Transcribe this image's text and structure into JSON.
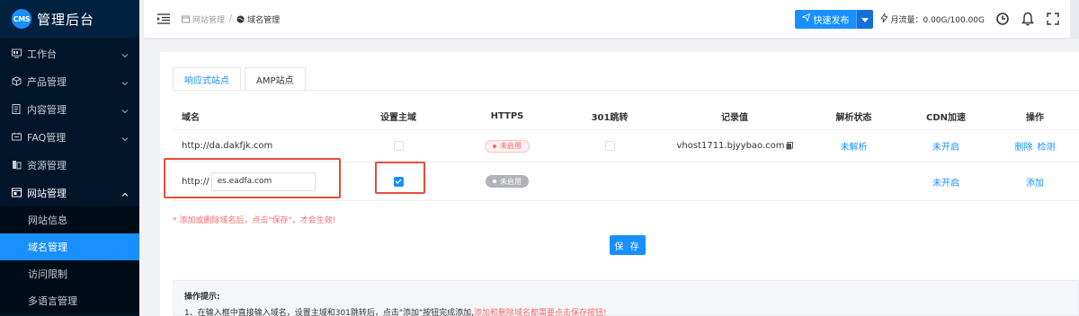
{
  "brand": {
    "logo": "CMS",
    "title": "管理后台"
  },
  "sidebar": {
    "items": [
      {
        "label": "工作台",
        "icon": "dashboard-icon",
        "caret": true
      },
      {
        "label": "产品管理",
        "icon": "cube-icon",
        "caret": true
      },
      {
        "label": "内容管理",
        "icon": "document-icon",
        "caret": true
      },
      {
        "label": "FAQ管理",
        "icon": "faq-icon",
        "caret": true
      },
      {
        "label": "资源管理",
        "icon": "resource-icon",
        "caret": false
      },
      {
        "label": "网站管理",
        "icon": "website-icon",
        "caret": true,
        "open": true
      }
    ],
    "subitems": [
      {
        "label": "网站信息",
        "active": false
      },
      {
        "label": "域名管理",
        "active": true
      },
      {
        "label": "访问限制",
        "active": false
      },
      {
        "label": "多语言管理",
        "active": false
      }
    ]
  },
  "header": {
    "breadcrumb": {
      "parent": "网站管理",
      "separator": "/",
      "current": "域名管理"
    },
    "publish_label": "快速发布",
    "flow_label": "月流量：0.00G/100.00G"
  },
  "tabs": [
    {
      "label": "响应式站点",
      "active": true
    },
    {
      "label": "AMP站点",
      "active": false
    }
  ],
  "table": {
    "headers": [
      "域名",
      "设置主域",
      "HTTPS",
      "301跳转",
      "记录值",
      "解析状态",
      "CDN加速",
      "操作"
    ],
    "row1": {
      "domain": "http://da.dakfjk.com",
      "https_status": "未启用",
      "record": "vhost1711.bjyybao.com",
      "resolve_status": "未解析",
      "cdn": "未开启",
      "action_delete": "删除",
      "action_check": "检测"
    },
    "row2": {
      "prefix": "http://",
      "input_value": "es.eadfa.com",
      "https_status": "未启用",
      "cdn": "未开启",
      "action_add": "添加"
    }
  },
  "warning": "* 添加或删除域名后，点击\"保存\"，才会生效!",
  "save_label": "保 存",
  "tips": {
    "title": "操作提示:",
    "line_prefix": "1、在输入框中直接输入域名，设置主域和301跳转后，点击\"添加\"按钮完成添加,",
    "line_red": "添加和删除域名都需要点击保存按钮!"
  },
  "colors": {
    "primary": "#1890ff",
    "sidebar_bg": "#001529",
    "danger": "#f56c6c"
  }
}
